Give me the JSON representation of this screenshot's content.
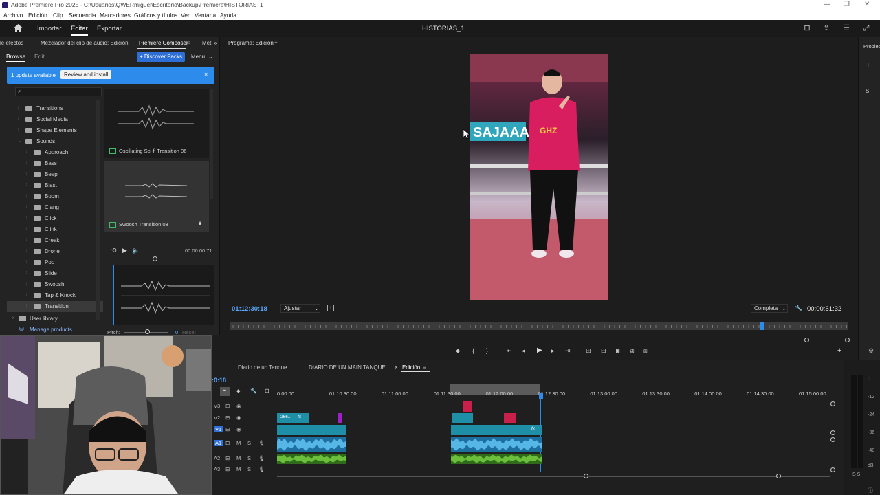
{
  "window": {
    "title": "Adobe Premiere Pro 2025 - C:\\Usuarios\\QWERmiguel\\Escritorio\\Backup\\Premiere\\HISTORIAS_1",
    "menu": [
      "Archivo",
      "Edición",
      "Clip",
      "Secuencia",
      "Marcadores",
      "Gráficos y títulos",
      "Ver",
      "Ventana",
      "Ayuda"
    ]
  },
  "header": {
    "nav": [
      "Importar",
      "Editar",
      "Exportar"
    ],
    "active_nav": "Editar",
    "project_title": "HISTORIAS_1"
  },
  "left_panel": {
    "tabs": [
      "le efectos",
      "Mezclador del clip de audio: Edición",
      "Premiere Composer",
      "Met"
    ],
    "subtabs": [
      "Browse",
      "Edit"
    ],
    "discover_button": "+ Discover Packs",
    "menu_button": "Menu",
    "update_banner": {
      "text": "1 update available",
      "button": "Review and install"
    },
    "tree": [
      {
        "label": "Transitions",
        "level": 1,
        "expanded": false
      },
      {
        "label": "Social Media",
        "level": 1,
        "expanded": false
      },
      {
        "label": "Shape Elements",
        "level": 1,
        "expanded": false
      },
      {
        "label": "Sounds",
        "level": 1,
        "expanded": true
      },
      {
        "label": "Approach",
        "level": 2
      },
      {
        "label": "Bass",
        "level": 2
      },
      {
        "label": "Beep",
        "level": 2
      },
      {
        "label": "Blast",
        "level": 2
      },
      {
        "label": "Boom",
        "level": 2
      },
      {
        "label": "Clang",
        "level": 2
      },
      {
        "label": "Click",
        "level": 2
      },
      {
        "label": "Clink",
        "level": 2
      },
      {
        "label": "Creak",
        "level": 2
      },
      {
        "label": "Drone",
        "level": 2
      },
      {
        "label": "Pop",
        "level": 2
      },
      {
        "label": "Slide",
        "level": 2
      },
      {
        "label": "Swoosh",
        "level": 2
      },
      {
        "label": "Tap & Knock",
        "level": 2
      },
      {
        "label": "Transition",
        "level": 2,
        "selected": true
      }
    ],
    "user_library": "User library",
    "manage_products": "Manage products",
    "sound_items": [
      {
        "label": "Oscillating Sci-fi Transition 06"
      },
      {
        "label": "Swoosh Transition 03"
      }
    ],
    "preview_time": "00:00:00.71",
    "pitch_label": "Pitch:",
    "pitch_value": "0",
    "reset_label": "Reset"
  },
  "monitor": {
    "tab": "Programa: Edición",
    "timecode": "01:12:30:18",
    "fit": "Ajustar",
    "quality": "Completa",
    "duration": "00:00:51:32"
  },
  "right_strip": {
    "tab": "Propiec"
  },
  "timeline": {
    "tabs": [
      "Diario de un Tanque",
      "DIARIO DE UN MAIN TANQUE",
      "Edición"
    ],
    "active_tab": "Edición",
    "timecode_partial": ":0:18",
    "ruler": [
      "0:00:00",
      "01:10:30:00",
      "01:11:00:00",
      "01:11:30:00",
      "01:12:00:00",
      "01:12:30:00",
      "01:13:00:00",
      "01:13:30:00",
      "01:14:00:00",
      "01:14:30:00",
      "01:15:00:00"
    ],
    "tracks": [
      "V3",
      "V2",
      "V1",
      "A1",
      "A2",
      "A3"
    ],
    "clip_label": "266...",
    "fx_label": "fx"
  },
  "meter": {
    "db_labels": [
      "0",
      "-12",
      "-24",
      "-36",
      "-48",
      "dB"
    ],
    "solo_labels": "S S"
  },
  "colors": {
    "accent_blue": "#2d8ceb",
    "clip_teal": "#1f8fa8",
    "audio_blue": "#56b7e6",
    "audio_green": "#6bbf3b",
    "marker_pink": "#c8204a",
    "marker_purple": "#a020c8"
  }
}
